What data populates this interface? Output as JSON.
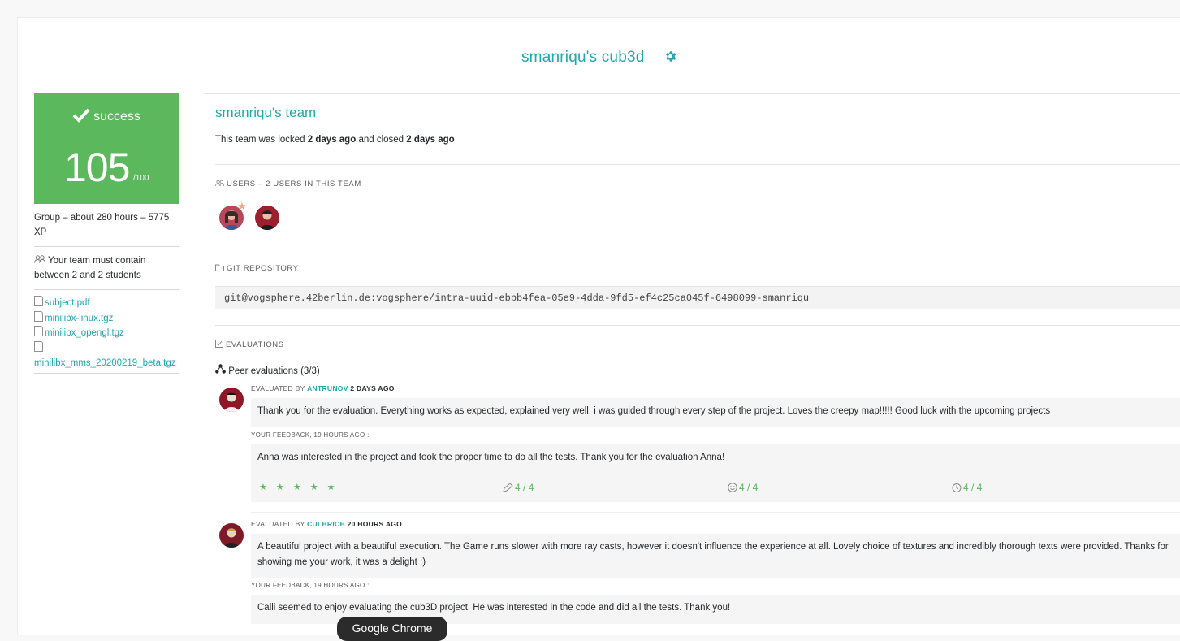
{
  "page": {
    "title": "smanriqu's cub3d"
  },
  "result": {
    "status": "success",
    "mark": "105",
    "max": "/100"
  },
  "project_info": {
    "group": "Group – about 280 hours – 5775 XP",
    "team_size": "Your team must contain between 2 and 2 students"
  },
  "files": [
    {
      "label": "subject.pdf"
    },
    {
      "label": "minilibx-linux.tgz"
    },
    {
      "label": "minilibx_opengl.tgz"
    },
    {
      "label": "minilibx_mms_20200219_beta.tgz"
    }
  ],
  "team": {
    "title": "smanriqu's team",
    "lock_prefix": "This team was locked",
    "locked": "2 days ago",
    "lock_middle": "and closed",
    "closed": "2 days ago"
  },
  "sections": {
    "users": "USERS – 2 USERS IN THIS TEAM",
    "git": "GIT REPOSITORY",
    "evaluations": "EVALUATIONS"
  },
  "repo_url": "git@vogsphere.42berlin.de:vogsphere/intra-uuid-ebbb4fea-05e9-4dda-9fd5-ef4c25ca045f-6498099-smanriqu",
  "peer_evaluations_label": "Peer evaluations (3/3)",
  "evaluations": [
    {
      "evaluated_by": "EVALUATED BY",
      "evaluator": "ANTRUNOV",
      "when": "2 DAYS AGO",
      "comment": "Thank you for the evaluation. Everything works as expected, explained very well, i was guided through every step of the project. Loves the creepy map!!!!! Good luck with the upcoming projects",
      "feedback_label": "YOUR FEEDBACK, 19 HOURS AGO :",
      "feedback": "Anna was interested in the project and took the proper time to do all the tests. Thank you for the evaluation Anna!",
      "stars": "★ ★ ★ ★ ★",
      "ratings": [
        "4 / 4",
        "4 / 4",
        "4 / 4"
      ]
    },
    {
      "evaluated_by": "EVALUATED BY",
      "evaluator": "CULBRICH",
      "when": "20 HOURS AGO",
      "comment": "A beautiful project with a beautiful execution. The Game runs slower with more ray casts, however it doesn't influence the experience at all. Lovely choice of textures and incredibly thorough texts were provided. Thanks for showing me your work, it was a delight :)",
      "feedback_label": "YOUR FEEDBACK, 19 HOURS AGO :",
      "feedback": "Calli seemed to enjoy evaluating the cub3D project. He was interested in the code and did all the tests. Thank you!"
    }
  ],
  "tooltip": "Google Chrome",
  "colors": {
    "accent": "#1fa8ad",
    "success": "#5cb85c"
  }
}
